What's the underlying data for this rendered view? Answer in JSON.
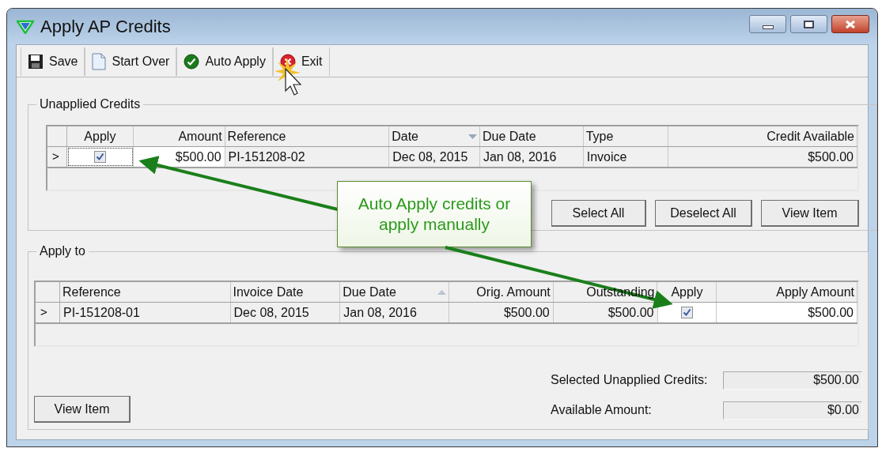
{
  "window": {
    "title": "Apply AP Credits"
  },
  "toolbar": [
    {
      "label": "Save"
    },
    {
      "label": "Start Over"
    },
    {
      "label": "Auto Apply"
    },
    {
      "label": "Exit"
    }
  ],
  "unapplied_credits": {
    "title": "Unapplied Credits",
    "columns": [
      {
        "label": "Apply",
        "kind": "checkbox",
        "sorted_down": false,
        "sorted_up": false
      },
      {
        "label": "Amount",
        "kind": "amount_input",
        "sorted_down": false,
        "sorted_up": false
      },
      {
        "label": "Reference",
        "kind": "text",
        "sorted_down": false,
        "sorted_up": false
      },
      {
        "label": "Date",
        "kind": "text",
        "sorted_down": true,
        "sorted_up": false
      },
      {
        "label": "Due Date",
        "kind": "text",
        "sorted_down": false,
        "sorted_up": false
      },
      {
        "label": "Type",
        "kind": "text",
        "sorted_down": false,
        "sorted_up": false
      },
      {
        "label": "Credit Available",
        "kind": "amount",
        "sorted_down": false,
        "sorted_up": false
      }
    ],
    "rows": [
      {
        "marker": ">",
        "cells": [
          {
            "checked": true,
            "focused": true
          },
          {
            "text": "$500.00"
          },
          {
            "text": "PI-151208-02"
          },
          {
            "text": "Dec 08, 2015"
          },
          {
            "text": "Jan 08, 2016"
          },
          {
            "text": "Invoice"
          },
          {
            "text": "$500.00"
          }
        ]
      }
    ],
    "buttons": [
      "Select All",
      "Deselect All",
      "View Item"
    ]
  },
  "apply_to": {
    "title": "Apply to",
    "columns": [
      {
        "label": "Reference",
        "kind": "text",
        "sorted_down": false,
        "sorted_up": false
      },
      {
        "label": "Invoice Date",
        "kind": "text",
        "sorted_down": false,
        "sorted_up": false
      },
      {
        "label": "Due Date",
        "kind": "text",
        "sorted_down": false,
        "sorted_up": true
      },
      {
        "label": "Orig. Amount",
        "kind": "amount",
        "sorted_down": false,
        "sorted_up": false
      },
      {
        "label": "Outstanding",
        "kind": "amount",
        "sorted_down": false,
        "sorted_up": false
      },
      {
        "label": "Apply",
        "kind": "checkbox",
        "sorted_down": false,
        "sorted_up": false
      },
      {
        "label": "Apply Amount",
        "kind": "amount_input",
        "sorted_down": false,
        "sorted_up": false
      }
    ],
    "rows": [
      {
        "marker": ">",
        "cells": [
          {
            "text": "PI-151208-01"
          },
          {
            "text": "Dec 08, 2015"
          },
          {
            "text": "Jan 08, 2016"
          },
          {
            "text": "$500.00"
          },
          {
            "text": "$500.00"
          },
          {
            "checked": true,
            "focused": false
          },
          {
            "text": "$500.00"
          }
        ]
      }
    ],
    "button": "View Item",
    "totals": [
      {
        "label": "Selected Unapplied Credits:",
        "value": "$500.00"
      },
      {
        "label": "Available Amount:",
        "value": "$0.00"
      }
    ]
  },
  "callout": {
    "text": "Auto Apply credits or apply manually"
  }
}
